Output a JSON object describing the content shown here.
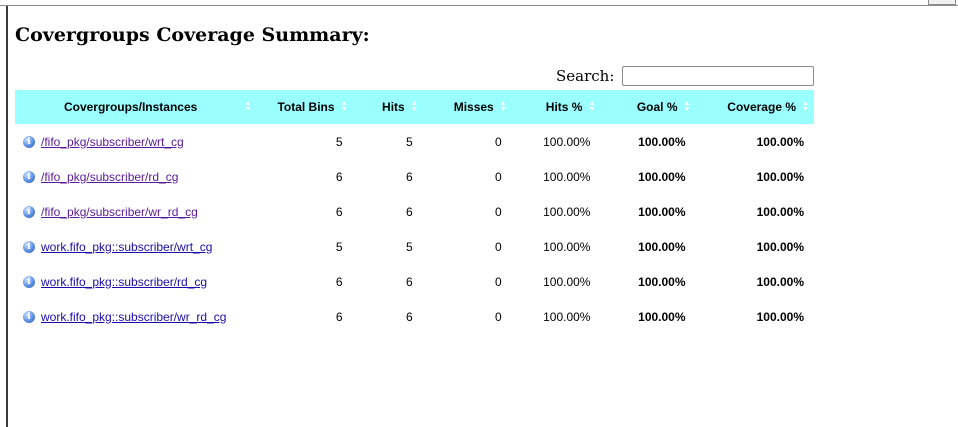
{
  "page": {
    "title": "Covergroups Coverage Summary:"
  },
  "search": {
    "label": "Search:",
    "value": ""
  },
  "table": {
    "headers": [
      "Covergroups/Instances",
      "Total Bins",
      "Hits",
      "Misses",
      "Hits %",
      "Goal %",
      "Coverage %"
    ],
    "rows": [
      {
        "name": "/fifo_pkg/subscriber/wrt_cg",
        "total_bins": "5",
        "hits": "5",
        "misses": "0",
        "hits_pct": "100.00%",
        "goal_pct": "100.00%",
        "coverage_pct": "100.00%"
      },
      {
        "name": "/fifo_pkg/subscriber/rd_cg",
        "total_bins": "6",
        "hits": "6",
        "misses": "0",
        "hits_pct": "100.00%",
        "goal_pct": "100.00%",
        "coverage_pct": "100.00%"
      },
      {
        "name": "/fifo_pkg/subscriber/wr_rd_cg",
        "total_bins": "6",
        "hits": "6",
        "misses": "0",
        "hits_pct": "100.00%",
        "goal_pct": "100.00%",
        "coverage_pct": "100.00%"
      },
      {
        "name": "work.fifo_pkg::subscriber/wrt_cg",
        "total_bins": "5",
        "hits": "5",
        "misses": "0",
        "hits_pct": "100.00%",
        "goal_pct": "100.00%",
        "coverage_pct": "100.00%"
      },
      {
        "name": "work.fifo_pkg::subscriber/rd_cg",
        "total_bins": "6",
        "hits": "6",
        "misses": "0",
        "hits_pct": "100.00%",
        "goal_pct": "100.00%",
        "coverage_pct": "100.00%"
      },
      {
        "name": "work.fifo_pkg::subscriber/wr_rd_cg",
        "total_bins": "6",
        "hits": "6",
        "misses": "0",
        "hits_pct": "100.00%",
        "goal_pct": "100.00%",
        "coverage_pct": "100.00%"
      }
    ]
  },
  "icons": {
    "row_icon": "info-icon",
    "sort_icon": "sort-arrows-icon"
  },
  "colors": {
    "header_bg": "#99ffff",
    "link": "#1a0dab",
    "visited_link": "#5b1a9a"
  }
}
